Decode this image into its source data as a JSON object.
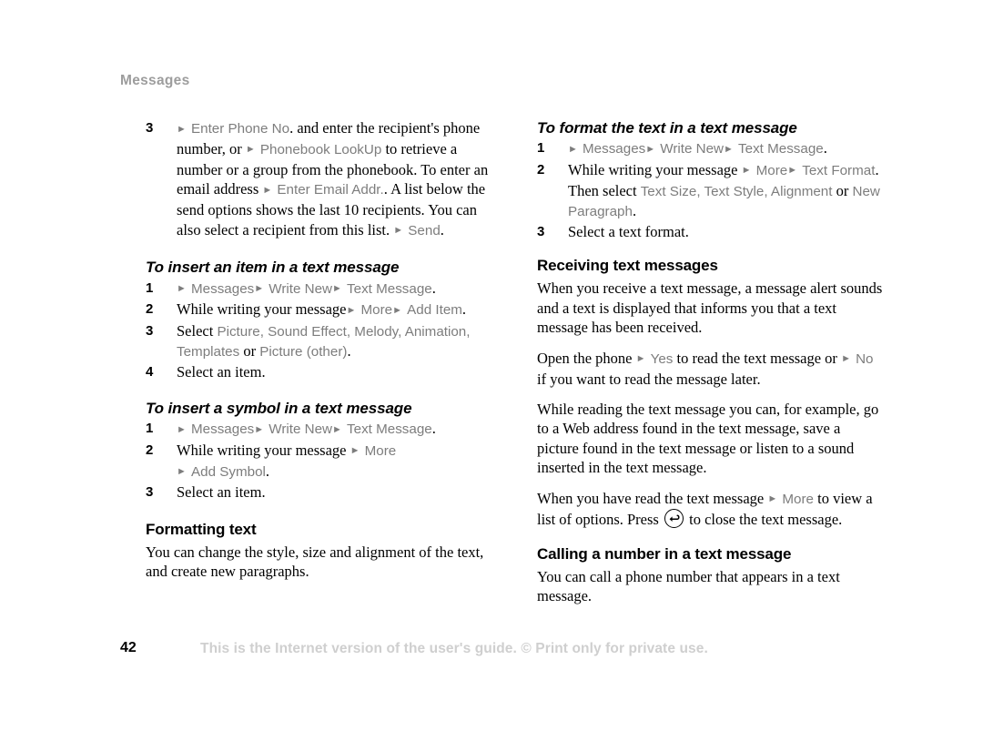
{
  "document": {
    "running_head": "Messages",
    "page_number": "42",
    "footer_note": "This is the Internet version of the user's guide. © Print only for private use.",
    "colors": {
      "ui_command_gray": "#7d7d7d",
      "running_head_gray": "#9d9d9d",
      "footer_gray": "#cfcfcf",
      "body_black": "#000000",
      "background": "#ffffff"
    },
    "arrow_glyph": "►"
  },
  "left_column": {
    "continued_step": {
      "number": "3",
      "parts": [
        {
          "type": "arrow"
        },
        {
          "type": "ui",
          "text": "Enter Phone No"
        },
        {
          "type": "body",
          "text": ". and enter the recipient's phone number, or "
        },
        {
          "type": "arrow"
        },
        {
          "type": "ui",
          "text": "Phonebook LookUp"
        },
        {
          "type": "body",
          "text": " to retrieve a number or a group from the phonebook. To enter an email address "
        },
        {
          "type": "arrow"
        },
        {
          "type": "ui",
          "text": "Enter Email Addr."
        },
        {
          "type": "body",
          "text": ". A list below the send options shows the last 10 recipients. You can also select a recipient from this list. "
        },
        {
          "type": "arrow"
        },
        {
          "type": "ui",
          "text": "Send"
        },
        {
          "type": "body",
          "text": "."
        }
      ]
    },
    "insert_item": {
      "heading": "To insert an item in a text message",
      "steps": [
        {
          "number": "1",
          "parts": [
            {
              "type": "arrow"
            },
            {
              "type": "ui",
              "text": "Messages"
            },
            {
              "type": "arrow"
            },
            {
              "type": "ui",
              "text": "Write New"
            },
            {
              "type": "arrow"
            },
            {
              "type": "ui",
              "text": "Text Message"
            },
            {
              "type": "body",
              "text": "."
            }
          ]
        },
        {
          "number": "2",
          "parts": [
            {
              "type": "body",
              "text": "While writing your message"
            },
            {
              "type": "arrow"
            },
            {
              "type": "ui",
              "text": "More"
            },
            {
              "type": "arrow"
            },
            {
              "type": "ui",
              "text": "Add Item"
            },
            {
              "type": "body",
              "text": "."
            }
          ]
        },
        {
          "number": "3",
          "parts": [
            {
              "type": "body",
              "text": "Select "
            },
            {
              "type": "ui",
              "text": "Picture, Sound Effect, Melody, Animation, Templates"
            },
            {
              "type": "body",
              "text": " or "
            },
            {
              "type": "ui",
              "text": "Picture (other)"
            },
            {
              "type": "body",
              "text": "."
            }
          ]
        },
        {
          "number": "4",
          "parts": [
            {
              "type": "body",
              "text": "Select an item."
            }
          ]
        }
      ]
    },
    "insert_symbol": {
      "heading": "To insert a symbol in a text message",
      "steps": [
        {
          "number": "1",
          "parts": [
            {
              "type": "arrow"
            },
            {
              "type": "ui",
              "text": "Messages"
            },
            {
              "type": "arrow"
            },
            {
              "type": "ui",
              "text": "Write New"
            },
            {
              "type": "arrow"
            },
            {
              "type": "ui",
              "text": "Text Message"
            },
            {
              "type": "body",
              "text": "."
            }
          ]
        },
        {
          "number": "2",
          "parts": [
            {
              "type": "body",
              "text": "While writing your message "
            },
            {
              "type": "arrow"
            },
            {
              "type": "ui",
              "text": "More"
            },
            {
              "type": "break"
            },
            {
              "type": "arrow"
            },
            {
              "type": "ui",
              "text": "Add Symbol"
            },
            {
              "type": "body",
              "text": "."
            }
          ]
        },
        {
          "number": "3",
          "parts": [
            {
              "type": "body",
              "text": "Select an item."
            }
          ]
        }
      ]
    },
    "formatting_text": {
      "heading": "Formatting text",
      "paragraph": "You can change the style, size and alignment of the text, and create new paragraphs."
    }
  },
  "right_column": {
    "format_text": {
      "heading": "To format the text in a text message",
      "steps": [
        {
          "number": "1",
          "parts": [
            {
              "type": "arrow"
            },
            {
              "type": "ui",
              "text": "Messages"
            },
            {
              "type": "arrow"
            },
            {
              "type": "ui",
              "text": "Write New"
            },
            {
              "type": "arrow"
            },
            {
              "type": "ui",
              "text": "Text Message"
            },
            {
              "type": "body",
              "text": "."
            }
          ]
        },
        {
          "number": "2",
          "parts": [
            {
              "type": "body",
              "text": "While writing your message "
            },
            {
              "type": "arrow"
            },
            {
              "type": "ui",
              "text": "More"
            },
            {
              "type": "arrow"
            },
            {
              "type": "ui",
              "text": "Text Format"
            },
            {
              "type": "body",
              "text": ". Then select "
            },
            {
              "type": "ui",
              "text": "Text Size, Text Style, Alignment"
            },
            {
              "type": "body",
              "text": " or "
            },
            {
              "type": "ui",
              "text": "New Paragraph"
            },
            {
              "type": "body",
              "text": "."
            }
          ]
        },
        {
          "number": "3",
          "parts": [
            {
              "type": "body",
              "text": "Select a text format."
            }
          ]
        }
      ]
    },
    "receiving": {
      "heading": "Receiving text messages",
      "paragraph_1": "When you receive a text message, a message alert sounds and a text is displayed that informs you that a text message has been received.",
      "paragraph_2": [
        {
          "type": "body",
          "text": "Open the phone "
        },
        {
          "type": "arrow"
        },
        {
          "type": "ui",
          "text": "Yes"
        },
        {
          "type": "body",
          "text": " to read the text message or "
        },
        {
          "type": "arrow"
        },
        {
          "type": "ui",
          "text": "No"
        },
        {
          "type": "body",
          "text": " if you want to read the message later."
        }
      ],
      "paragraph_3": "While reading the text message you can, for example, go to a Web address found in the text message, save a picture found in the text message or listen to a sound inserted in the text message.",
      "paragraph_4": [
        {
          "type": "body",
          "text": "When you have read the text message "
        },
        {
          "type": "arrow"
        },
        {
          "type": "ui",
          "text": "More"
        },
        {
          "type": "body",
          "text": " to view a list of options. Press "
        },
        {
          "type": "icon",
          "name": "back-key-icon"
        },
        {
          "type": "body",
          "text": " to close the text message."
        }
      ]
    },
    "calling": {
      "heading": "Calling a number in a text message",
      "paragraph": "You can call a phone number that appears in a text message."
    }
  }
}
